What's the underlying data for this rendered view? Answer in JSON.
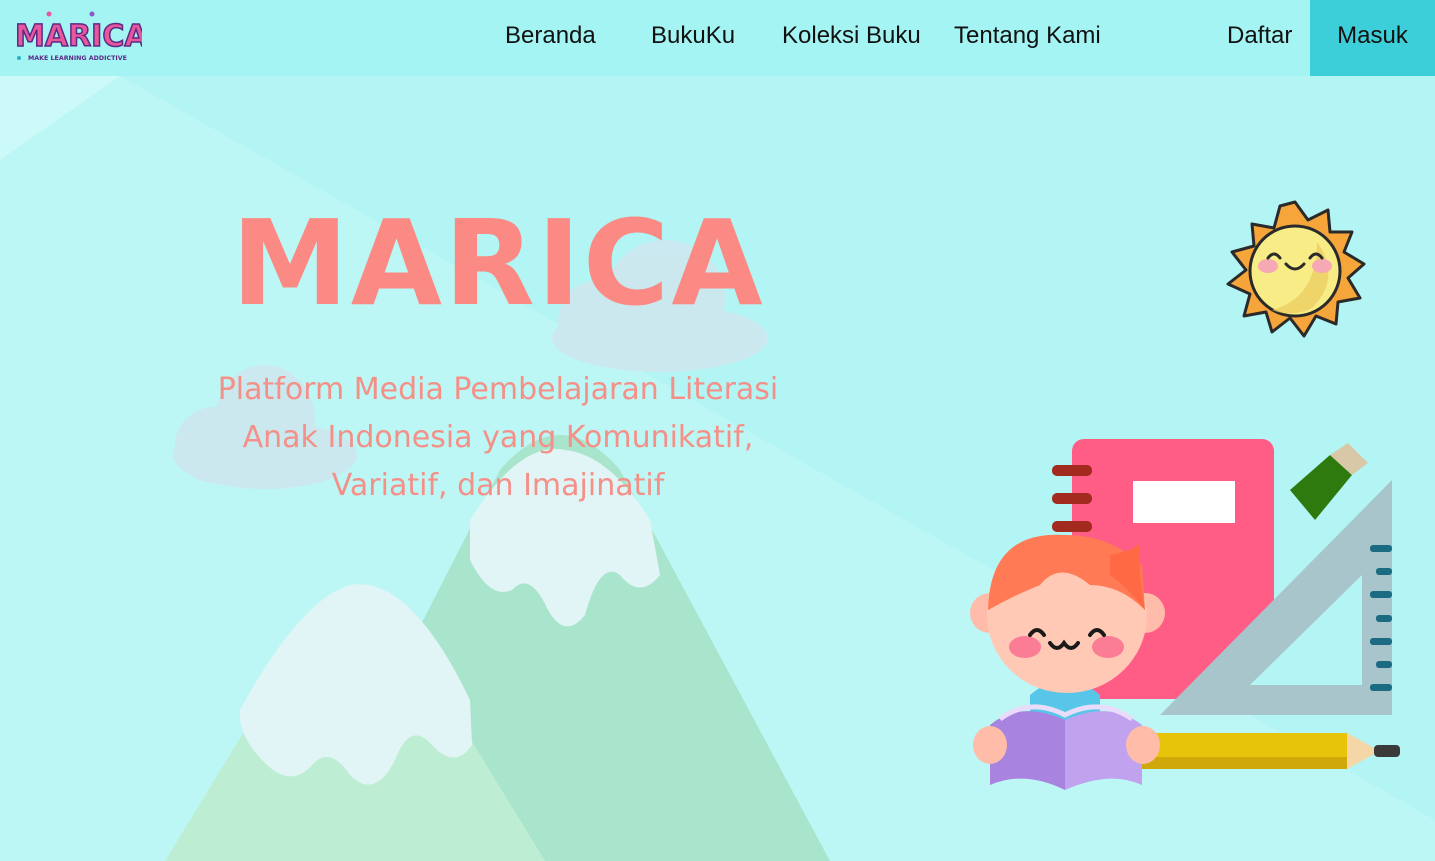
{
  "brand": {
    "logo_text": "MARICA",
    "tagline": "MAKE LEARNING ADDICTIVE"
  },
  "nav": {
    "links": [
      "Beranda",
      "BukuKu",
      "Koleksi Buku",
      "Tentang Kami"
    ],
    "register_label": "Daftar",
    "login_label": "Masuk"
  },
  "hero": {
    "title": "MARICA",
    "subtitle_lines": [
      "Platform Media Pembelajaran Literasi",
      "Anak Indonesia yang Komunikatif,",
      "Variatif, dan Imajinatif"
    ]
  },
  "colors": {
    "nav_bg": "#a3f4f3",
    "login_bg": "#3dcfd9",
    "title": "#fb8a84",
    "subtitle": "#f49088",
    "page_bg": "#b2f5f4"
  },
  "icons": [
    "sun-illustration",
    "kid-reading-illustration",
    "mountain-illustration",
    "cloud-illustration"
  ]
}
